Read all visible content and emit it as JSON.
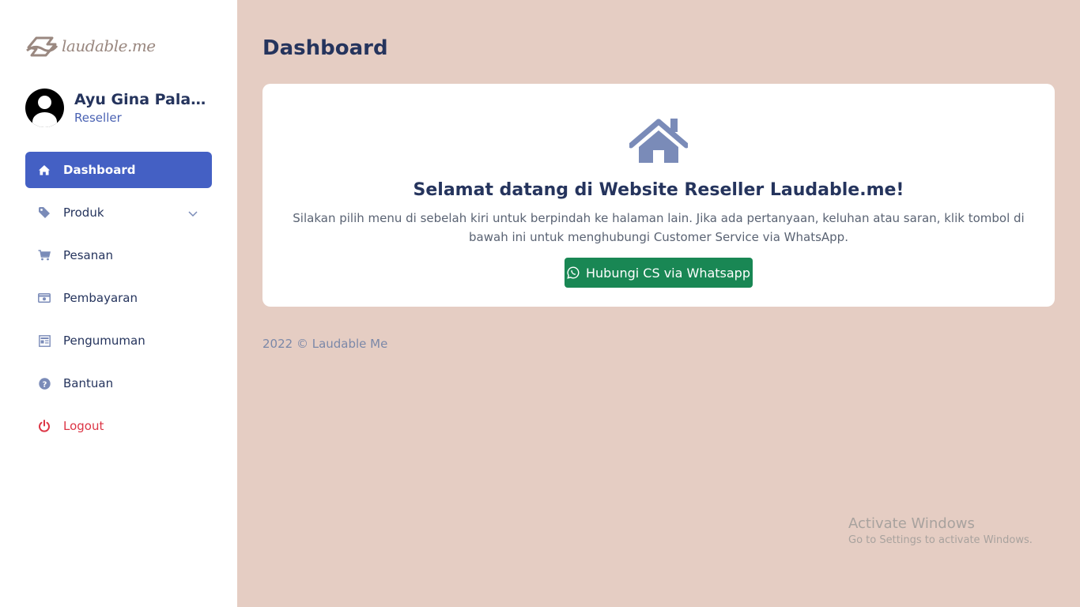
{
  "brand": {
    "logo_text": "laudable.me"
  },
  "profile": {
    "name": "Ayu Gina Palas...",
    "role": "Reseller"
  },
  "sidebar": {
    "items": [
      {
        "label": "Dashboard",
        "icon": "home-icon",
        "active": true
      },
      {
        "label": "Produk",
        "icon": "tag-icon",
        "has_dropdown": true
      },
      {
        "label": "Pesanan",
        "icon": "cart-icon"
      },
      {
        "label": "Pembayaran",
        "icon": "money-icon"
      },
      {
        "label": "Pengumuman",
        "icon": "newspaper-icon"
      },
      {
        "label": "Bantuan",
        "icon": "question-icon"
      },
      {
        "label": "Logout",
        "icon": "power-icon"
      }
    ]
  },
  "main": {
    "page_title": "Dashboard",
    "card": {
      "icon": "home-icon",
      "welcome": "Selamat datang di Website Reseller Laudable.me!",
      "description": "Silakan pilih menu di sebelah kiri untuk berpindah ke halaman lain. Jika ada pertanyaan, keluhan atau saran, klik tombol di bawah ini untuk menghubungi Customer Service via WhatsApp.",
      "button_label": "Hubungi CS via Whatsapp"
    },
    "footer": "2022 © Laudable Me"
  },
  "watermark": {
    "title": "Activate Windows",
    "subtitle": "Go to Settings to activate Windows."
  },
  "colors": {
    "background": "#e5cdc3",
    "primary": "#4460c4",
    "heading": "#25345d",
    "button": "#198754",
    "logout": "#dc3545",
    "icon": "#7a8bb8"
  }
}
